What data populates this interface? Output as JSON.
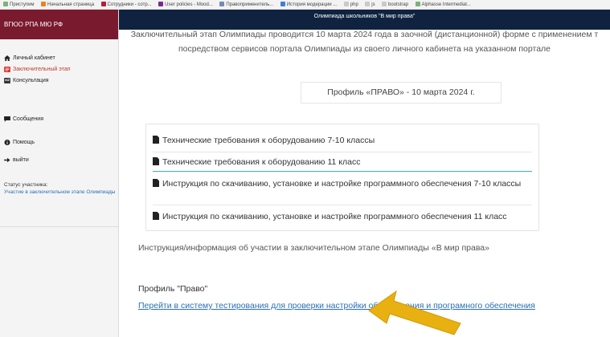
{
  "bookmarks": [
    {
      "label": "Приступим",
      "color": "#7bb17b"
    },
    {
      "label": "Начальная страница",
      "color": "#e2852b"
    },
    {
      "label": "Сотрудники - сотр...",
      "color": "#b0203a"
    },
    {
      "label": "User policies - Mood...",
      "color": "#7a2a8c"
    },
    {
      "label": "Правоприменитель...",
      "color": "#6e8cb5"
    },
    {
      "label": "История модерации ...",
      "color": "#3f7fd6"
    },
    {
      "label": "php",
      "color": "#c9c9c9"
    },
    {
      "label": "js",
      "color": "#c9c9c9"
    },
    {
      "label": "bootstrap",
      "color": "#c9c9c9"
    },
    {
      "label": "Alphasse Intermediat...",
      "color": "#7bb17b"
    }
  ],
  "brand": {
    "label": "ВГЮО РПА МЮ РФ",
    "color": "#7a1a2e"
  },
  "sidebar": {
    "items": [
      {
        "label": "Личный кабинет",
        "icon": "home-icon",
        "active": false
      },
      {
        "label": "Заключительный этап",
        "icon": "stage-icon",
        "active": true
      },
      {
        "label": "Консультация",
        "icon": "consult-icon",
        "active": false
      },
      {
        "label": "Сообщения",
        "icon": "message-icon",
        "active": false
      },
      {
        "label": "Помощь",
        "icon": "info-icon",
        "active": false
      },
      {
        "label": "выйти",
        "icon": "logout-icon",
        "active": false
      }
    ],
    "status_label": "Статус участника:",
    "status_value": "Участие в заключительном этапе Олимпиады"
  },
  "header": {
    "title": "Олимпиада школьников \"В мир права\"",
    "color": "#0f2340"
  },
  "banner": {
    "line1": "Заключительный этап Олимпиады проводится 10 марта 2024 года в заочной (дистанционной) форме с применением т",
    "line2": "посредством сервисов портала Олимпиады из своего личного кабинета на указанном портале"
  },
  "profile_box": "Профиль «ПРАВО» - 10 марта 2024 г.",
  "documents": [
    {
      "label": "Технические требования к оборудованию 7-10 классы"
    },
    {
      "label": "Технические требования к оборудованию 11 класс"
    },
    {
      "label": "Инструкция по скачиванию, установке и настройке программного обеспечения 7-10 классы"
    },
    {
      "label": "Инструкция по скачиванию, установке и настройке программного обеспечения 11 класс"
    }
  ],
  "info_text": "Инструкция/информация об участии в заключительном этапе Олимпиады «В мир права»",
  "section_title": "Профиль \"Право\"",
  "test_link": "Перейти в систему тестирования для проверки настройки оборудования и програмного обеспечения",
  "accent": {
    "link": "#2a6fb4",
    "active": "#c0392b",
    "arrow": "#e8b010"
  }
}
